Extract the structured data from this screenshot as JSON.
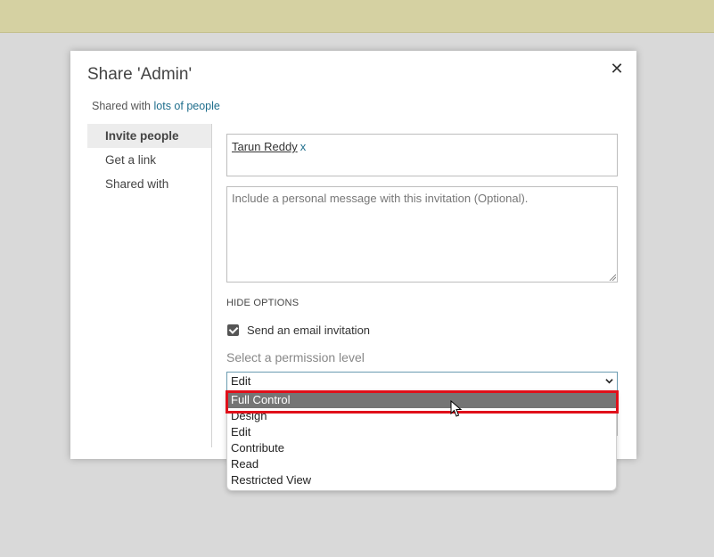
{
  "dialog": {
    "title": "Share 'Admin'",
    "close_label": "✕",
    "shared_with_prefix": "Shared with",
    "shared_with_link": "lots of people"
  },
  "nav": {
    "items": [
      {
        "label": "Invite people"
      },
      {
        "label": "Get a link"
      },
      {
        "label": "Shared with"
      }
    ]
  },
  "invite": {
    "person": "Tarun Reddy",
    "remove_label": "x",
    "message_placeholder": "Include a personal message with this invitation (Optional).",
    "hide_options": "HIDE OPTIONS",
    "send_email_label": "Send an email invitation",
    "send_email_checked": true,
    "permission_label": "Select a permission level",
    "permission_selected": "Edit"
  },
  "dropdown": {
    "options": [
      {
        "label": "Full Control"
      },
      {
        "label": "Design"
      },
      {
        "label": "Edit"
      },
      {
        "label": "Contribute"
      },
      {
        "label": "Read"
      },
      {
        "label": "Restricted View"
      }
    ],
    "highlighted_index": 0
  },
  "colors": {
    "top_band": "#d5d1a2",
    "link": "#1f6e8c",
    "highlight_border": "#e0101a",
    "selected_option": "#757575"
  },
  "icons": {
    "close": "close-icon",
    "chevron": "chevron-down-icon",
    "checkbox": "checkmark-icon",
    "cursor": "mouse-cursor-icon"
  }
}
